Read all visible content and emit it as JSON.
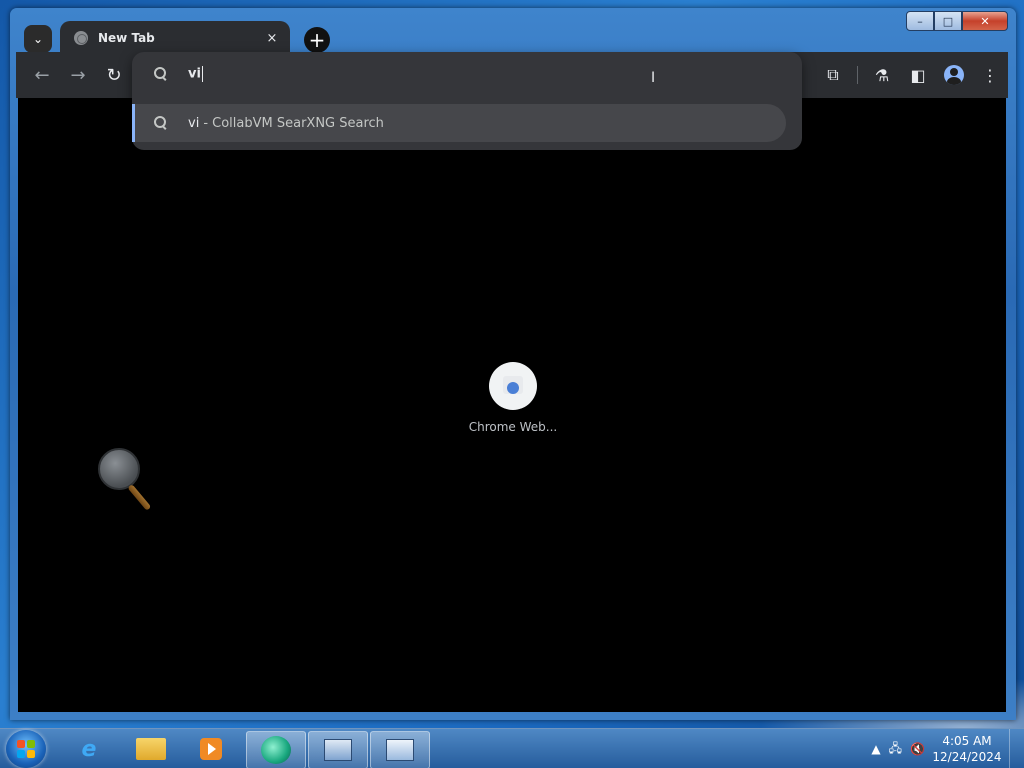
{
  "browser": {
    "tab": {
      "title": "New Tab",
      "close_icon": "×"
    },
    "newtab_label": "+",
    "tab_search_icon": "⌄",
    "nav": {
      "back": "←",
      "forward": "→",
      "reload": "↻"
    },
    "omnibox": {
      "typed": "vi"
    },
    "suggestion": {
      "query": "vi",
      "description": "- CollabVM SearXNG Search"
    },
    "toolbar_right": {
      "extensions": "⧉",
      "labs": "⚗",
      "side_panel": "◧",
      "menu": "⋮"
    }
  },
  "new_tab_page": {
    "shortcuts": [
      {
        "label": "Chrome Web..."
      }
    ]
  },
  "window_controls": {
    "minimize": "–",
    "maximize": "□",
    "close": "✕"
  },
  "taskbar": {
    "clock": {
      "time": "4:05 AM",
      "date": "12/24/2024"
    },
    "tray": {
      "show_hidden": "▲",
      "network": "🖧",
      "volume": "🔇"
    }
  },
  "colors": {
    "accent": "#8ab4f8",
    "toolbar": "#2b2d31",
    "omnibox": "#35363a"
  }
}
